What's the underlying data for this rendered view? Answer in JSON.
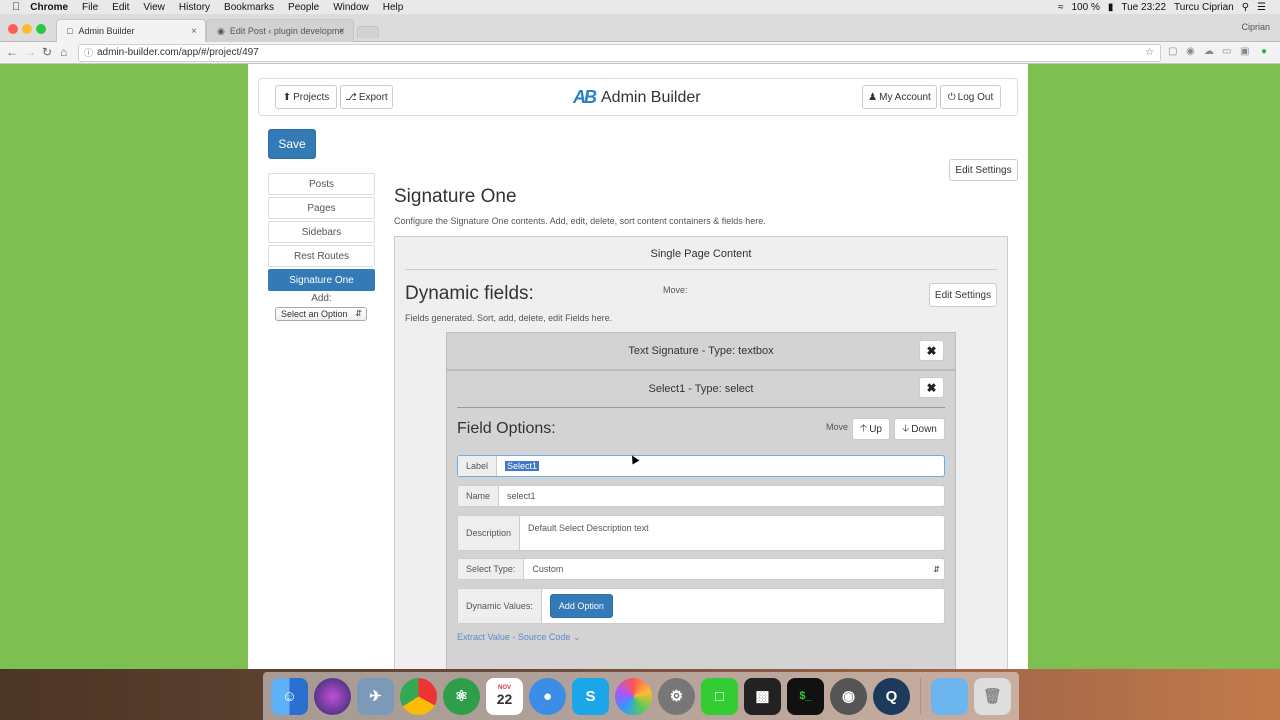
{
  "mac_menu": {
    "app": "Chrome",
    "items": [
      "File",
      "Edit",
      "View",
      "History",
      "Bookmarks",
      "People",
      "Window",
      "Help"
    ],
    "battery": "100 %",
    "time": "Tue 23:22",
    "user": "Turcu Ciprian"
  },
  "browser": {
    "profile": "Ciprian",
    "tabs": [
      {
        "title": "Admin Builder"
      },
      {
        "title": "Edit Post ‹ plugin developmen"
      }
    ],
    "url": "admin-builder.com/app/#/project/497"
  },
  "header": {
    "projects_label": "Projects",
    "export_label": "Export",
    "brand_name": "Admin Builder",
    "logo_text": "AB",
    "account_label": "My Account",
    "logout_label": "Log Out"
  },
  "save_label": "Save",
  "edit_settings_label": "Edit Settings",
  "sidebar": {
    "items": [
      {
        "label": "Posts"
      },
      {
        "label": "Pages"
      },
      {
        "label": "Sidebars"
      },
      {
        "label": "Rest Routes"
      },
      {
        "label": "Signature One"
      }
    ],
    "add_label": "Add:",
    "add_select": "Select an Option"
  },
  "main": {
    "title": "Signature One",
    "description": "Configure the Signature One contents. Add, edit, delete, sort content containers & fields here.",
    "panel_title": "Single Page Content",
    "dynamic_title": "Dynamic fields:",
    "move_label": "Move:",
    "edit_settings_label": "Edit Settings",
    "dynamic_desc": "Fields generated. Sort, add, delete, edit Fields here.",
    "fields": [
      {
        "title": "Text Signature - Type: textbox"
      },
      {
        "title": "Select1 - Type: select"
      }
    ],
    "field_options": {
      "title": "Field Options:",
      "move_label": "Move",
      "up_label": "Up",
      "down_label": "Down",
      "label_addon": "Label",
      "label_value": "Select1",
      "name_addon": "Name",
      "name_value": "select1",
      "desc_addon": "Description",
      "desc_value": "Default Select Description text",
      "type_addon": "Select Type:",
      "type_value": "Custom",
      "dyn_addon": "Dynamic Values:",
      "add_option_label": "Add Option",
      "extract_link": "Extract Value - Source Code"
    }
  },
  "dock": {
    "calendar_month": "NOV",
    "calendar_day": "22"
  }
}
